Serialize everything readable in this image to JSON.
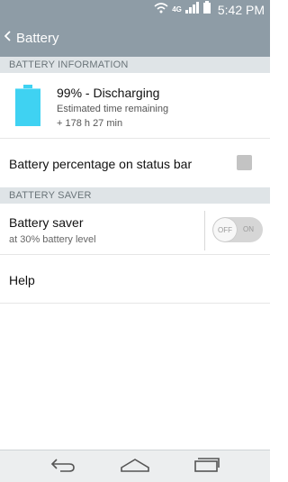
{
  "status_bar": {
    "network": "4G",
    "time": "5:42 PM"
  },
  "app_bar": {
    "title": "Battery"
  },
  "battery_info": {
    "section_title": "BATTERY INFORMATION",
    "status": "99% - Discharging",
    "remaining_label": "Estimated time remaining",
    "remaining_value": "+ 178 h 27 min",
    "level_percent": 99,
    "battery_color": "#3fd2f2"
  },
  "status_bar_setting": {
    "label": "Battery percentage on status bar",
    "checked": false
  },
  "battery_saver": {
    "section_title": "BATTERY SAVER",
    "label": "Battery saver",
    "sublabel": "at 30% battery level",
    "toggle_off": "OFF",
    "toggle_on": "ON",
    "enabled": false
  },
  "help": {
    "label": "Help"
  },
  "colors": {
    "header": "#8e9ca6",
    "section": "#dfe4e7"
  },
  "nav": {
    "back": "back-icon",
    "home": "home-icon",
    "recents": "recents-icon"
  }
}
